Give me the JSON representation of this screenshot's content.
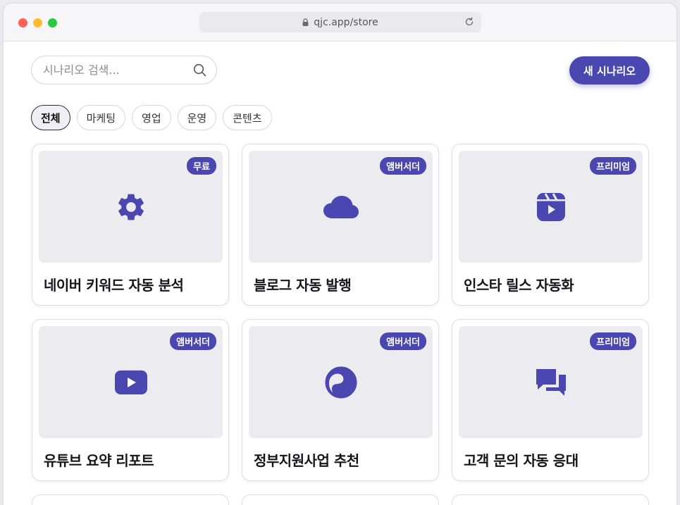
{
  "browser": {
    "url": "qjc.app/store"
  },
  "toolbar": {
    "search_placeholder": "시나리오 검색...",
    "new_button_label": "새 시나리오"
  },
  "filters": [
    {
      "label": "전체",
      "active": true
    },
    {
      "label": "마케팅",
      "active": false
    },
    {
      "label": "영업",
      "active": false
    },
    {
      "label": "운영",
      "active": false
    },
    {
      "label": "콘텐츠",
      "active": false
    }
  ],
  "cards": [
    {
      "title": "네이버 키워드 자동 분석",
      "badge": "무료",
      "icon": "gear-icon"
    },
    {
      "title": "블로그 자동 발행",
      "badge": "앰버서더",
      "icon": "cloud-icon"
    },
    {
      "title": "인스타 릴스 자동화",
      "badge": "프리미엄",
      "icon": "reels-icon"
    },
    {
      "title": "유튜브 요약 리포트",
      "badge": "앰버서더",
      "icon": "youtube-icon"
    },
    {
      "title": "정부지원사업 추천",
      "badge": "앰버서더",
      "icon": "government-emblem-icon"
    },
    {
      "title": "고객 문의 자동 응대",
      "badge": "프리미엄",
      "icon": "chat-bubbles-icon"
    }
  ],
  "colors": {
    "accent": "#4a47b1",
    "thumb_bg": "#ebebf0"
  }
}
